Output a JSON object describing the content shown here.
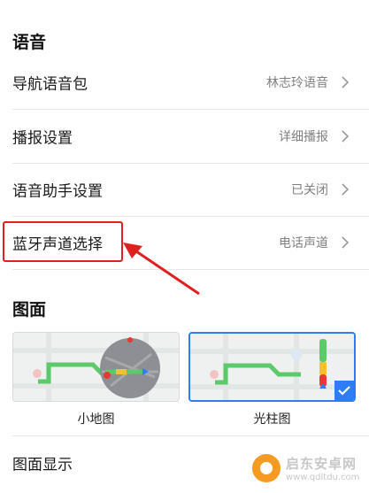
{
  "voice_section": {
    "title": "语音",
    "rows": [
      {
        "label": "导航语音包",
        "value": "林志玲语音"
      },
      {
        "label": "播报设置",
        "value": "详细播报"
      },
      {
        "label": "语音助手设置",
        "value": "已关闭"
      },
      {
        "label": "蓝牙声道选择",
        "value": "电话声道"
      }
    ]
  },
  "map_section": {
    "title": "图面",
    "options": [
      {
        "label": "小地图",
        "selected": false
      },
      {
        "label": "光柱图",
        "selected": true
      }
    ],
    "display_row": {
      "label": "图面显示"
    }
  },
  "colors": {
    "highlight": "#e0201e",
    "accent": "#2e7cf6",
    "route_green": "#5cc96a"
  },
  "icons": [
    "chevron-right-icon",
    "checkmark-icon",
    "pointer-arrow-icon"
  ],
  "watermark": {
    "text": "启东安卓网",
    "url": "www.qdltdu.com"
  }
}
